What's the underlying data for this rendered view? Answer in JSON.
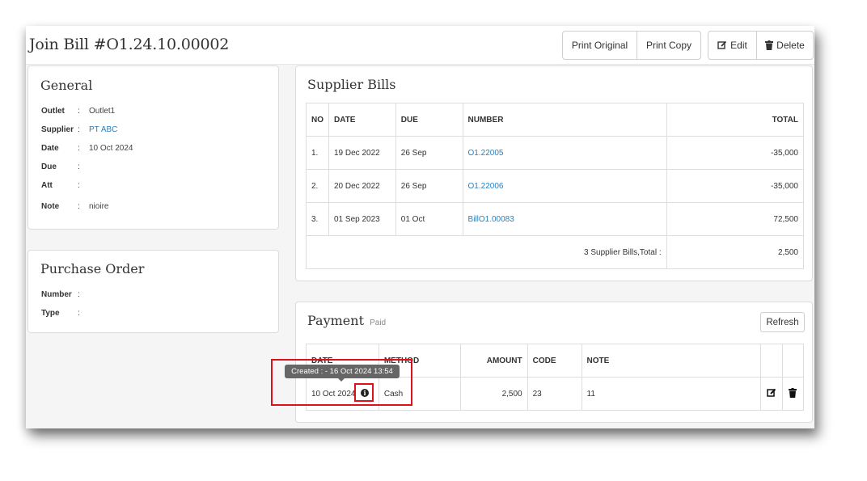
{
  "page": {
    "title": "Join Bill #O1.24.10.00002"
  },
  "toolbar": {
    "print_original_label": "Print Original",
    "print_copy_label": "Print Copy",
    "edit_label": "Edit",
    "delete_label": "Delete",
    "edit_icon": "edit-icon",
    "delete_icon": "trash-icon"
  },
  "general": {
    "title": "General",
    "fields": [
      {
        "label": "Outlet",
        "value": "Outlet1"
      },
      {
        "label": "Supplier",
        "value": "PT ABC"
      },
      {
        "label": "Date",
        "value": "10 Oct 2024"
      },
      {
        "label": "Due",
        "value": ""
      },
      {
        "label": "Att",
        "value": ""
      },
      {
        "label": "Note",
        "value": "nioire"
      }
    ]
  },
  "purchase_order": {
    "title": "Purchase Order",
    "fields": [
      {
        "label": "Number",
        "value": ""
      },
      {
        "label": "Type",
        "value": ""
      }
    ]
  },
  "supplier_bills": {
    "title": "Supplier Bills",
    "headers": {
      "no": "NO",
      "date": "DATE",
      "due": "DUE",
      "number": "NUMBER",
      "total": "TOTAL"
    },
    "rows": [
      {
        "no": "1.",
        "date": "19 Dec 2022",
        "due": "26 Sep",
        "number": "O1.22005",
        "total": "-35,000"
      },
      {
        "no": "2.",
        "date": "20 Dec 2022",
        "due": "26 Sep",
        "number": "O1.22006",
        "total": "-35,000"
      },
      {
        "no": "3.",
        "date": "01 Sep 2023",
        "due": "01 Oct",
        "number": "BillO1.00083",
        "total": "72,500"
      }
    ],
    "footer_label": "3 Supplier Bills,Total :",
    "footer_total": "2,500"
  },
  "payment": {
    "title": "Payment",
    "status": "Paid",
    "refresh_label": "Refresh",
    "headers": {
      "date": "DATE",
      "method": "METHOD",
      "amount": "AMOUNT",
      "code": "CODE",
      "note": "NOTE"
    },
    "rows": [
      {
        "date": "10 Oct 2024",
        "method": "Cash",
        "amount": "2,500",
        "code": "23",
        "note": "11"
      }
    ],
    "tooltip": "Created : - 16 Oct 2024 13:54",
    "info_glyph": "i"
  },
  "colors": {
    "link": "#2a7fbf",
    "highlight": "#e0101a",
    "tooltip_bg": "#666666"
  }
}
